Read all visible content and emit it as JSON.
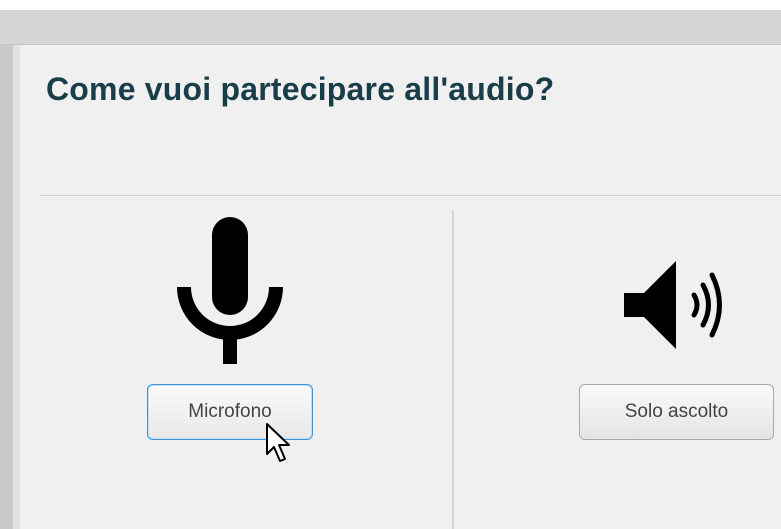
{
  "dialog": {
    "title": "Come vuoi partecipare all'audio?"
  },
  "options": {
    "microphone": {
      "icon": "microphone-icon",
      "label": "Microfono"
    },
    "listen_only": {
      "icon": "speaker-icon",
      "label": "Solo ascolto"
    }
  },
  "colors": {
    "title": "#1a3d4a",
    "focus_border": "#3d93d6",
    "background": "#f0f0f0"
  }
}
